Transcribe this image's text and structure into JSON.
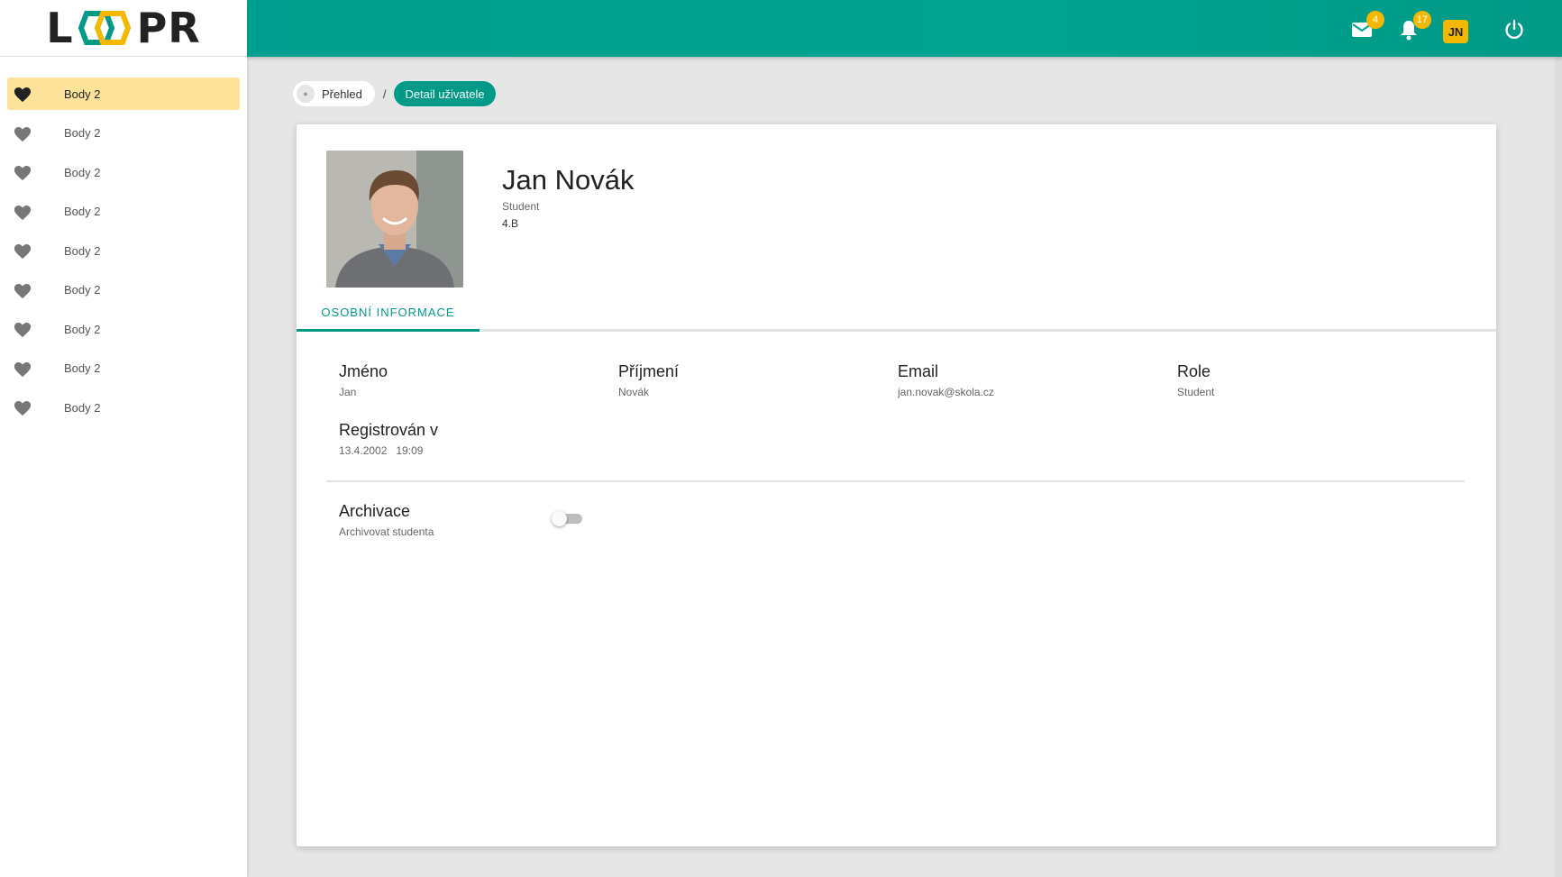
{
  "logo": {
    "text_left": "L",
    "text_right": "PR",
    "accent_colors": [
      "#f5b800",
      "#009a87"
    ]
  },
  "sidebar": {
    "items": [
      {
        "label": "Body 2",
        "icon": "heart-icon",
        "active": true
      },
      {
        "label": "Body 2",
        "icon": "heart-icon",
        "active": false
      },
      {
        "label": "Body 2",
        "icon": "heart-icon",
        "active": false
      },
      {
        "label": "Body 2",
        "icon": "heart-icon",
        "active": false
      },
      {
        "label": "Body 2",
        "icon": "heart-icon",
        "active": false
      },
      {
        "label": "Body 2",
        "icon": "heart-icon",
        "active": false
      },
      {
        "label": "Body 2",
        "icon": "heart-icon",
        "active": false
      },
      {
        "label": "Body 2",
        "icon": "heart-icon",
        "active": false
      },
      {
        "label": "Body 2",
        "icon": "heart-icon",
        "active": false
      }
    ]
  },
  "topbar": {
    "mail": {
      "icon": "mail-icon",
      "badge": "4"
    },
    "notifications": {
      "icon": "bell-icon",
      "badge": "17"
    },
    "user_initials": "JN",
    "power_icon": "power-icon"
  },
  "breadcrumb": {
    "home_label": "Přehled",
    "separator": "/",
    "current_label": "Detail uživatele"
  },
  "profile": {
    "name": "Jan Novák",
    "role": "Student",
    "class": "4.B"
  },
  "tabs": [
    {
      "label": "OSOBNÍ INFORMACE",
      "active": true
    }
  ],
  "fields": {
    "first_name": {
      "label": "Jméno",
      "value": "Jan"
    },
    "last_name": {
      "label": "Příjmení",
      "value": "Novák"
    },
    "email": {
      "label": "Email",
      "value": "jan.novak@skola.cz"
    },
    "role": {
      "label": "Role",
      "value": "Student"
    },
    "registered": {
      "label": "Registrován v",
      "value": "13.4.2002   19:09"
    }
  },
  "archive": {
    "label": "Archivace",
    "description": "Archivovat studenta",
    "enabled": false
  },
  "colors": {
    "primary": "#009a87",
    "accent": "#f5b800",
    "active_nav": "#fde29a"
  }
}
